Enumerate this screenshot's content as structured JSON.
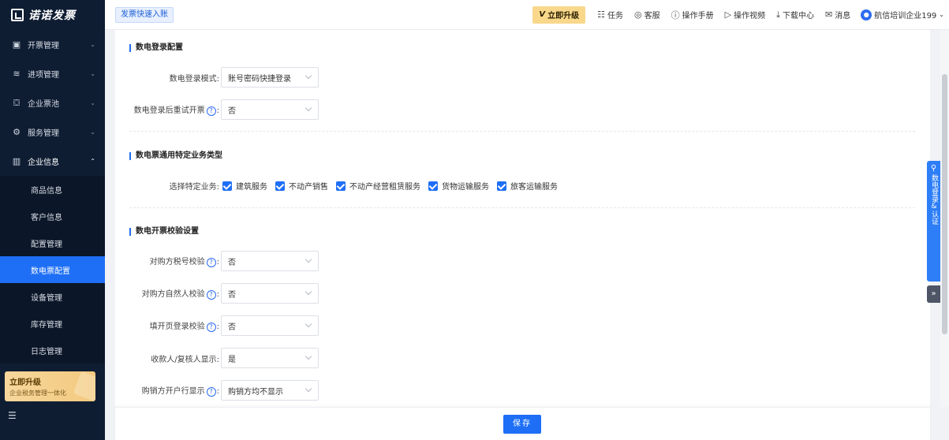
{
  "app": {
    "logo_text": "诺诺发票"
  },
  "sidebar": {
    "menus": [
      {
        "icon": "invoice-icon",
        "glyph": "▣",
        "label": "开票管理",
        "arrow": "⌄"
      },
      {
        "icon": "stack-icon",
        "glyph": "≋",
        "label": "进项管理",
        "arrow": "⌄"
      },
      {
        "icon": "pool-icon",
        "glyph": "⛋",
        "label": "企业票池",
        "arrow": "⌄"
      },
      {
        "icon": "service-icon",
        "glyph": "⚙",
        "label": "服务管理",
        "arrow": "⌄"
      },
      {
        "icon": "enterprise-icon",
        "glyph": "▥",
        "label": "企业信息",
        "arrow": "⌃"
      }
    ],
    "submenu": [
      "商品信息",
      "客户信息",
      "配置管理",
      "数电票配置",
      "设备管理",
      "库存管理",
      "日志管理"
    ],
    "active_sub": "数电票配置",
    "upgrade": {
      "title": "立即升级",
      "subtitle": "企业税务管理一体化"
    }
  },
  "topbar": {
    "quick_entry": "发票快速入账",
    "upgrade": "立即升级",
    "links": [
      {
        "icon": "task-icon",
        "glyph": "☷",
        "label": "任务"
      },
      {
        "icon": "support-icon",
        "glyph": "◎",
        "label": "客服"
      },
      {
        "icon": "manual-icon",
        "glyph": "ⓘ",
        "label": "操作手册"
      },
      {
        "icon": "video-icon",
        "glyph": "▷",
        "label": "操作视频"
      },
      {
        "icon": "download-icon",
        "glyph": "⤓",
        "label": "下载中心"
      },
      {
        "icon": "mail-icon",
        "glyph": "✉",
        "label": "消息"
      }
    ],
    "user": "航信培训企业199"
  },
  "sections": {
    "login": {
      "title": "数电登录配置",
      "mode_label": "数电登录模式:",
      "mode_value": "账号密码快捷登录",
      "retry_label": "数电登录后重试开票",
      "retry_value": "否"
    },
    "business": {
      "title": "数电票通用特定业务类型",
      "label": "选择特定业务:",
      "options": [
        "建筑服务",
        "不动产销售",
        "不动产经营租赁服务",
        "货物运输服务",
        "旅客运输服务"
      ]
    },
    "check": {
      "title": "数电开票校验设置",
      "rows": [
        {
          "label": "对购方税号校验",
          "help": true,
          "value": "否"
        },
        {
          "label": "对购方自然人校验",
          "help": true,
          "value": "否"
        },
        {
          "label": "填开页登录校验",
          "help": true,
          "value": "否"
        },
        {
          "label": "收款人/复核人显示:",
          "help": false,
          "value": "是"
        },
        {
          "label": "购销方开户行显示",
          "help": true,
          "value": "购销方均不显示"
        }
      ]
    }
  },
  "footer": {
    "save": "保存"
  },
  "side_tab": {
    "text": "数电登录&认证",
    "toggle": "»"
  },
  "colors": {
    "primary": "#1e6ff5",
    "sidebar_bg": "#0f1d33",
    "upgrade_gold": "#f9d88c"
  }
}
